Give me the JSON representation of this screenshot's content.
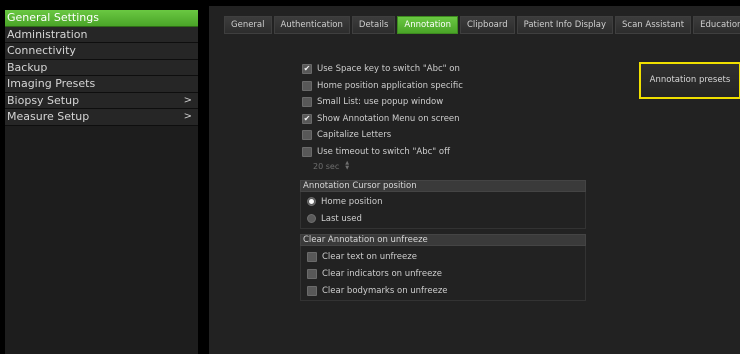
{
  "sidebar": {
    "items": [
      {
        "label": "General Settings",
        "arrow": ""
      },
      {
        "label": "Administration",
        "arrow": ""
      },
      {
        "label": "Connectivity",
        "arrow": ""
      },
      {
        "label": "Backup",
        "arrow": ""
      },
      {
        "label": "Imaging Presets",
        "arrow": ""
      },
      {
        "label": "Biopsy Setup",
        "arrow": ">"
      },
      {
        "label": "Measure Setup",
        "arrow": ">"
      }
    ],
    "active_index": 0
  },
  "tabs": {
    "items": [
      "General",
      "Authentication",
      "Details",
      "Annotation",
      "Clipboard",
      "Patient Info Display",
      "Scan Assistant",
      "Education"
    ],
    "active_index": 3
  },
  "annotation": {
    "presets_button": "Annotation presets",
    "options": [
      {
        "label": "Use Space key to switch \"Abc\" on",
        "checked": true
      },
      {
        "label": "Home position application specific",
        "checked": false
      },
      {
        "label": "Small List: use popup window",
        "checked": false
      },
      {
        "label": "Show Annotation Menu on screen",
        "checked": true
      },
      {
        "label": "Capitalize Letters",
        "checked": false
      },
      {
        "label": "Use timeout to switch \"Abc\" off",
        "checked": false
      }
    ],
    "timeout_value": "20 sec",
    "cursor_group": {
      "title": "Annotation Cursor position",
      "options": [
        {
          "label": "Home position",
          "selected": true
        },
        {
          "label": "Last used",
          "selected": false
        }
      ]
    },
    "clear_group": {
      "title": "Clear Annotation on unfreeze",
      "options": [
        {
          "label": "Clear text on unfreeze",
          "checked": false
        },
        {
          "label": "Clear indicators on unfreeze",
          "checked": false
        },
        {
          "label": "Clear bodymarks on unfreeze",
          "checked": false
        }
      ]
    }
  },
  "colors": {
    "accent_green": "#5bb635",
    "highlight_yellow": "#f0e000",
    "background": "#000000",
    "panel": "#222222"
  }
}
